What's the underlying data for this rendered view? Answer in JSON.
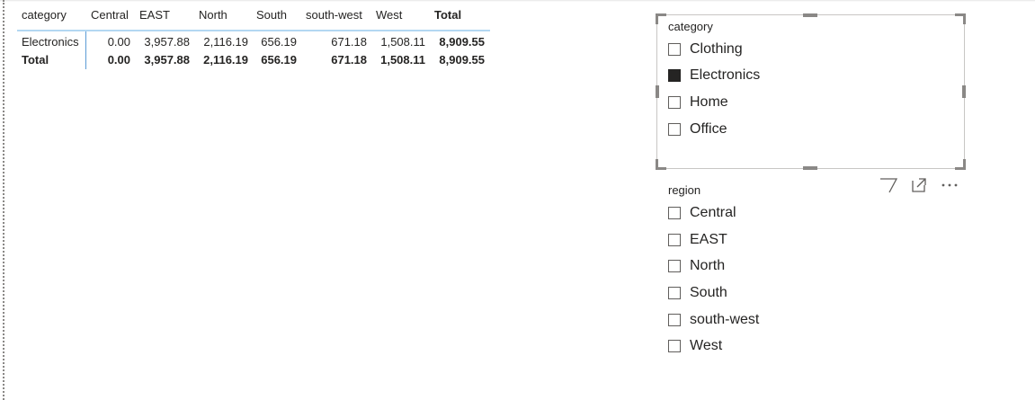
{
  "matrix": {
    "headers": {
      "category": "category",
      "central": "Central",
      "east": "EAST",
      "north": "North",
      "south": "South",
      "south_west": "south-west",
      "west": "West",
      "total": "Total"
    },
    "rows": [
      {
        "label": "Electronics",
        "central": "0.00",
        "east": "3,957.88",
        "north": "2,116.19",
        "south": "656.19",
        "south_west": "671.18",
        "west": "1,508.11",
        "total": "8,909.55"
      },
      {
        "label": "Total",
        "central": "0.00",
        "east": "3,957.88",
        "north": "2,116.19",
        "south": "656.19",
        "south_west": "671.18",
        "west": "1,508.11",
        "total": "8,909.55"
      }
    ]
  },
  "category_slicer": {
    "title": "category",
    "items": [
      {
        "label": "Clothing",
        "checked": false
      },
      {
        "label": "Electronics",
        "checked": true
      },
      {
        "label": "Home",
        "checked": false
      },
      {
        "label": "Office",
        "checked": false
      }
    ]
  },
  "region_slicer": {
    "title": "region",
    "items": [
      {
        "label": "Central",
        "checked": false
      },
      {
        "label": "EAST",
        "checked": false
      },
      {
        "label": "North",
        "checked": false
      },
      {
        "label": "South",
        "checked": false
      },
      {
        "label": "south-west",
        "checked": false
      },
      {
        "label": "West",
        "checked": false
      }
    ]
  },
  "visual_toolbar": {
    "icons": [
      "filter-icon",
      "focus-mode-icon",
      "more-options-icon"
    ]
  },
  "colors": {
    "checked": "#252423",
    "header_line": "#b3d7f2",
    "row_separator": "#5b9bd5",
    "frame_handle": "#8a8886"
  }
}
